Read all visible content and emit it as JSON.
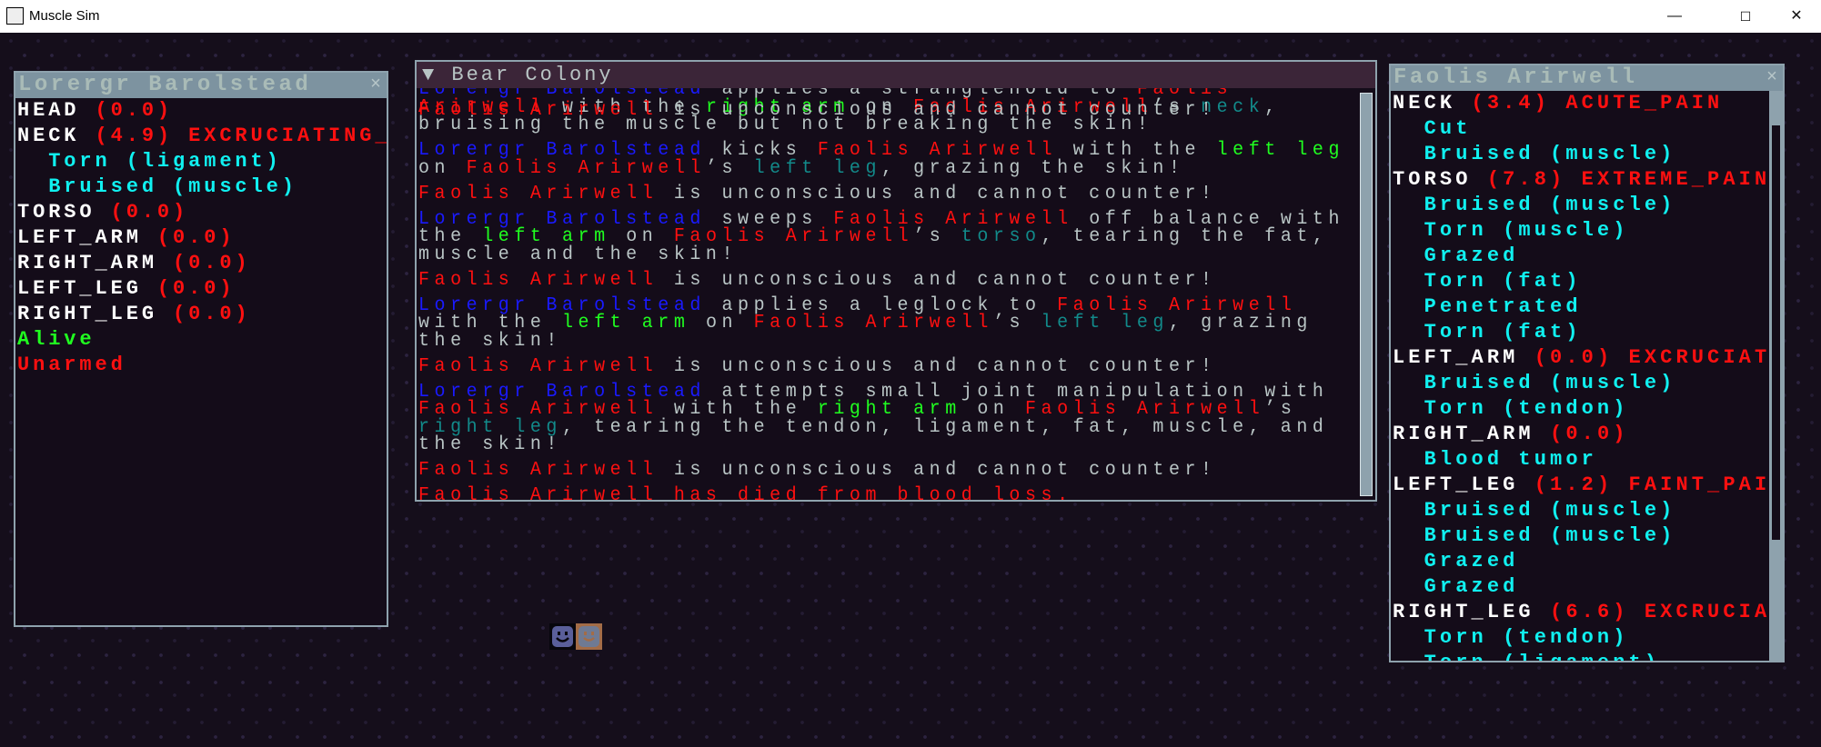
{
  "window": {
    "title": "Muscle Sim",
    "icon_label": "raylib",
    "minimize": "—",
    "maximize": "☐",
    "close": "✕"
  },
  "left_panel": {
    "title": "Lorergr Barolstead",
    "close": "×",
    "lines": [
      [
        [
          "w",
          "HEAD "
        ],
        [
          "r",
          "(0.0)"
        ]
      ],
      [
        [
          "w",
          "NECK "
        ],
        [
          "r",
          "(4.9) EXCRUCIATING_"
        ]
      ],
      [
        [
          "c",
          "  Torn (ligament)"
        ]
      ],
      [
        [
          "c",
          "  Bruised (muscle)"
        ]
      ],
      [
        [
          "w",
          "TORSO "
        ],
        [
          "r",
          "(0.0)"
        ]
      ],
      [
        [
          "w",
          "LEFT_ARM "
        ],
        [
          "r",
          "(0.0)"
        ]
      ],
      [
        [
          "w",
          "RIGHT_ARM "
        ],
        [
          "r",
          "(0.0)"
        ]
      ],
      [
        [
          "w",
          "LEFT_LEG "
        ],
        [
          "r",
          "(0.0)"
        ]
      ],
      [
        [
          "w",
          "RIGHT_LEG "
        ],
        [
          "r",
          "(0.0)"
        ]
      ],
      [
        [
          "g",
          "Alive"
        ]
      ],
      [
        [
          "r",
          "Unarmed"
        ]
      ]
    ]
  },
  "log": {
    "title": "Bear Colony",
    "arrow": "▼",
    "overlay": [
      [
        "r",
        "Faolis Arirwell"
      ],
      [
        "x",
        " is unconscious and cannot counter!"
      ]
    ],
    "entries": [
      [
        [
          [
            "b",
            "Lorergr Barolstead"
          ],
          [
            "x",
            " applies a stranglehold to "
          ],
          [
            "r",
            "Faolis"
          ]
        ],
        [
          [
            "r",
            "Arirwell"
          ],
          [
            "x",
            " with the "
          ],
          [
            "g",
            "right arm"
          ],
          [
            "x",
            " on "
          ],
          [
            "r",
            "Faolis Arirwell"
          ],
          [
            "x",
            "’s "
          ],
          [
            "t",
            "neck"
          ],
          [
            "x",
            ","
          ]
        ],
        [
          [
            "x",
            "bruising the muscle but not breaking the skin!"
          ]
        ]
      ],
      [
        [
          [
            "b",
            "Lorergr Barolstead"
          ],
          [
            "x",
            " kicks "
          ],
          [
            "r",
            "Faolis Arirwell"
          ],
          [
            "x",
            " with the "
          ],
          [
            "g",
            "left leg"
          ]
        ],
        [
          [
            "x",
            "on "
          ],
          [
            "r",
            "Faolis Arirwell"
          ],
          [
            "x",
            "’s "
          ],
          [
            "t",
            "left leg"
          ],
          [
            "x",
            ", grazing the skin!"
          ]
        ]
      ],
      [
        [
          [
            "r",
            "Faolis Arirwell"
          ],
          [
            "x",
            " is unconscious and cannot counter!"
          ]
        ]
      ],
      [
        [
          [
            "b",
            "Lorergr Barolstead"
          ],
          [
            "x",
            " sweeps "
          ],
          [
            "r",
            "Faolis Arirwell"
          ],
          [
            "x",
            " off balance with"
          ]
        ],
        [
          [
            "x",
            "the "
          ],
          [
            "g",
            "left arm"
          ],
          [
            "x",
            " on "
          ],
          [
            "r",
            "Faolis Arirwell"
          ],
          [
            "x",
            "’s "
          ],
          [
            "t",
            "torso"
          ],
          [
            "x",
            ", tearing the fat,"
          ]
        ],
        [
          [
            "x",
            "muscle and the skin!"
          ]
        ]
      ],
      [
        [
          [
            "r",
            "Faolis Arirwell"
          ],
          [
            "x",
            " is unconscious and cannot counter!"
          ]
        ]
      ],
      [
        [
          [
            "b",
            "Lorergr Barolstead"
          ],
          [
            "x",
            " applies a leglock to "
          ],
          [
            "r",
            "Faolis Arirwell"
          ]
        ],
        [
          [
            "x",
            "with the "
          ],
          [
            "g",
            "left arm"
          ],
          [
            "x",
            " on "
          ],
          [
            "r",
            "Faolis Arirwell"
          ],
          [
            "x",
            "’s "
          ],
          [
            "t",
            "left leg"
          ],
          [
            "x",
            ", grazing"
          ]
        ],
        [
          [
            "x",
            "the skin!"
          ]
        ]
      ],
      [
        [
          [
            "r",
            "Faolis Arirwell"
          ],
          [
            "x",
            " is unconscious and cannot counter!"
          ]
        ]
      ],
      [
        [
          [
            "b",
            "Lorergr Barolstead"
          ],
          [
            "x",
            " attempts small joint manipulation with"
          ]
        ],
        [
          [
            "r",
            "Faolis Arirwell"
          ],
          [
            "x",
            " with the "
          ],
          [
            "g",
            "right arm"
          ],
          [
            "x",
            " on "
          ],
          [
            "r",
            "Faolis Arirwell"
          ],
          [
            "x",
            "’s"
          ]
        ],
        [
          [
            "t",
            "right leg"
          ],
          [
            "x",
            ", tearing the tendon, ligament, fat, muscle, and"
          ]
        ],
        [
          [
            "x",
            "the skin!"
          ]
        ]
      ],
      [
        [
          [
            "r",
            "Faolis Arirwell"
          ],
          [
            "x",
            " is unconscious and cannot counter!"
          ]
        ]
      ],
      [
        [
          [
            "r",
            "Faolis Arirwell has died from blood loss."
          ]
        ]
      ]
    ]
  },
  "right_panel": {
    "title": "Faolis Arirwell",
    "close": "×",
    "lines": [
      [
        [
          "w",
          "NECK "
        ],
        [
          "r",
          "(3.4) ACUTE_PAIN"
        ]
      ],
      [
        [
          "c",
          "  Cut"
        ]
      ],
      [
        [
          "c",
          "  Bruised (muscle)"
        ]
      ],
      [
        [
          "w",
          "TORSO "
        ],
        [
          "r",
          "(7.8) EXTREME_PAIN"
        ]
      ],
      [
        [
          "c",
          "  Bruised (muscle)"
        ]
      ],
      [
        [
          "c",
          "  Torn (muscle)"
        ]
      ],
      [
        [
          "c",
          "  Grazed"
        ]
      ],
      [
        [
          "c",
          "  Torn (fat)"
        ]
      ],
      [
        [
          "c",
          "  Penetrated"
        ]
      ],
      [
        [
          "c",
          "  Torn (fat)"
        ]
      ],
      [
        [
          "w",
          "LEFT_ARM "
        ],
        [
          "r",
          "(0.0) EXCRUCIAT"
        ]
      ],
      [
        [
          "c",
          "  Bruised (muscle)"
        ]
      ],
      [
        [
          "c",
          "  Torn (tendon)"
        ]
      ],
      [
        [
          "w",
          "RIGHT_ARM "
        ],
        [
          "r",
          "(0.0)"
        ]
      ],
      [
        [
          "c",
          "  Blood tumor"
        ]
      ],
      [
        [
          "w",
          "LEFT_LEG "
        ],
        [
          "r",
          "(1.2) FAINT_PAI"
        ]
      ],
      [
        [
          "c",
          "  Bruised (muscle)"
        ]
      ],
      [
        [
          "c",
          "  Bruised (muscle)"
        ]
      ],
      [
        [
          "c",
          "  Grazed"
        ]
      ],
      [
        [
          "c",
          "  Grazed"
        ]
      ],
      [
        [
          "w",
          "RIGHT_LEG "
        ],
        [
          "r",
          "(6.6) EXCRUCIAT"
        ]
      ],
      [
        [
          "c",
          "  Torn (tendon)"
        ]
      ],
      [
        [
          "c",
          "  Torn (ligament)"
        ]
      ]
    ]
  },
  "colors": {
    "background": "#150e1b",
    "enemy": "#ff1010",
    "player": "#1a1aff",
    "limb": "#20ff20",
    "target": "#128a8a",
    "wound": "#10f0f0"
  },
  "sprites": [
    "player-face-icon",
    "enemy-face-icon"
  ]
}
